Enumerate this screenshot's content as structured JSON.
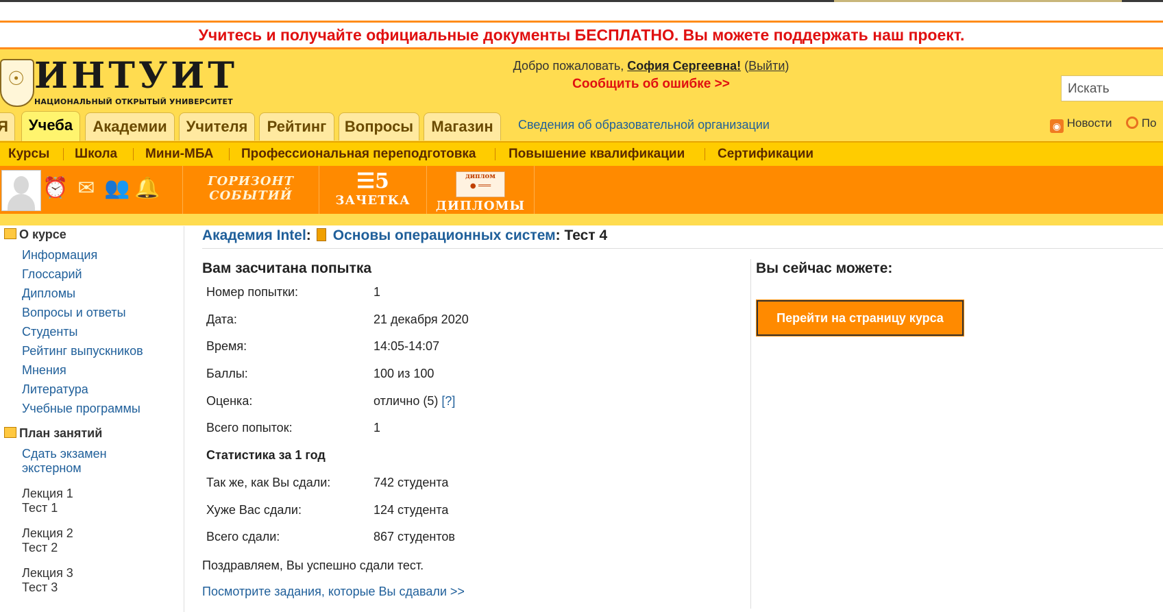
{
  "promo": "Учитесь и получайте официальные документы БЕСПЛАТНО. Вы можете поддержать наш проект.",
  "logo": {
    "word": "ИНТУИТ",
    "subtitle": "НАЦИОНАЛЬНЫЙ ОТКРЫТЫЙ УНИВЕРСИТЕТ"
  },
  "user": {
    "welcome_prefix": "Добро пожаловать, ",
    "name": "София Сергеевна!",
    "logout": "Выйти",
    "report_error": "Сообщить об ошибке >>"
  },
  "search": {
    "placeholder": "Искать"
  },
  "tabs": [
    "Я",
    "Учеба",
    "Академии",
    "Учителя",
    "Рейтинг",
    "Вопросы",
    "Магазин"
  ],
  "active_tab": "Учеба",
  "org_info": "Сведения об образовательной организации",
  "news": "Новости",
  "help": "По",
  "subnav": [
    "Курсы",
    "Школа",
    "Мини-МБА",
    "Профессиональная переподготовка",
    "Повышение квалификации",
    "Сертификации"
  ],
  "toolbar": {
    "horizon_1": "ГОРИЗОНТ",
    "horizon_2": "СОБЫТИЙ",
    "gradebook": "ЗАЧЕТКА",
    "gradebook_num": "5",
    "diplomas": "ДИПЛОМЫ",
    "diploma_tag": "диплом",
    "icons": [
      "alarm-clock-icon",
      "envelope-icon",
      "people-icon",
      "bell-icon"
    ]
  },
  "sidebar": {
    "about_heading": "О курсе",
    "about_items": [
      "Информация",
      "Глоссарий",
      "Дипломы",
      "Вопросы и ответы",
      "Студенты",
      "Рейтинг выпускников",
      "Мнения",
      "Литература",
      "Учебные программы"
    ],
    "plan_heading": "План занятий",
    "plan_link_1": "Сдать экзамен",
    "plan_link_2": "экстерном",
    "lessons": [
      {
        "lecture": "Лекция 1",
        "test": "Тест 1"
      },
      {
        "lecture": "Лекция 2",
        "test": "Тест 2"
      },
      {
        "lecture": "Лекция 3",
        "test": "Тест 3"
      }
    ]
  },
  "breadcrumb": {
    "academy": "Академия Intel",
    "course": "Основы операционных систем",
    "colon": ":",
    "test": "Тест 4"
  },
  "result": {
    "heading": "Вам засчитана попытка",
    "rows": [
      {
        "label": "Номер попытки:",
        "value": "1"
      },
      {
        "label": "Дата:",
        "value": "21 декабря 2020"
      },
      {
        "label": "Время:",
        "value": "14:05-14:07"
      },
      {
        "label": "Баллы:",
        "value": "100 из 100"
      },
      {
        "label": "Оценка:",
        "value": "отлично (5)",
        "help": "[?]"
      },
      {
        "label": "Всего попыток:",
        "value": "1"
      }
    ],
    "stats_heading": "Статистика за 1 год",
    "stats": [
      {
        "label": "Так же, как Вы сдали:",
        "value": "742 студента"
      },
      {
        "label": "Хуже Вас сдали:",
        "value": "124 студента"
      },
      {
        "label": "Всего сдали:",
        "value": "867 студентов"
      }
    ],
    "congrats": "Поздравляем, Вы успешно сдали тест.",
    "view_tasks": "Посмотрите задания, которые Вы сдавали >>"
  },
  "actions": {
    "heading": "Вы сейчас можете:",
    "go_course": "Перейти на страницу курса"
  }
}
